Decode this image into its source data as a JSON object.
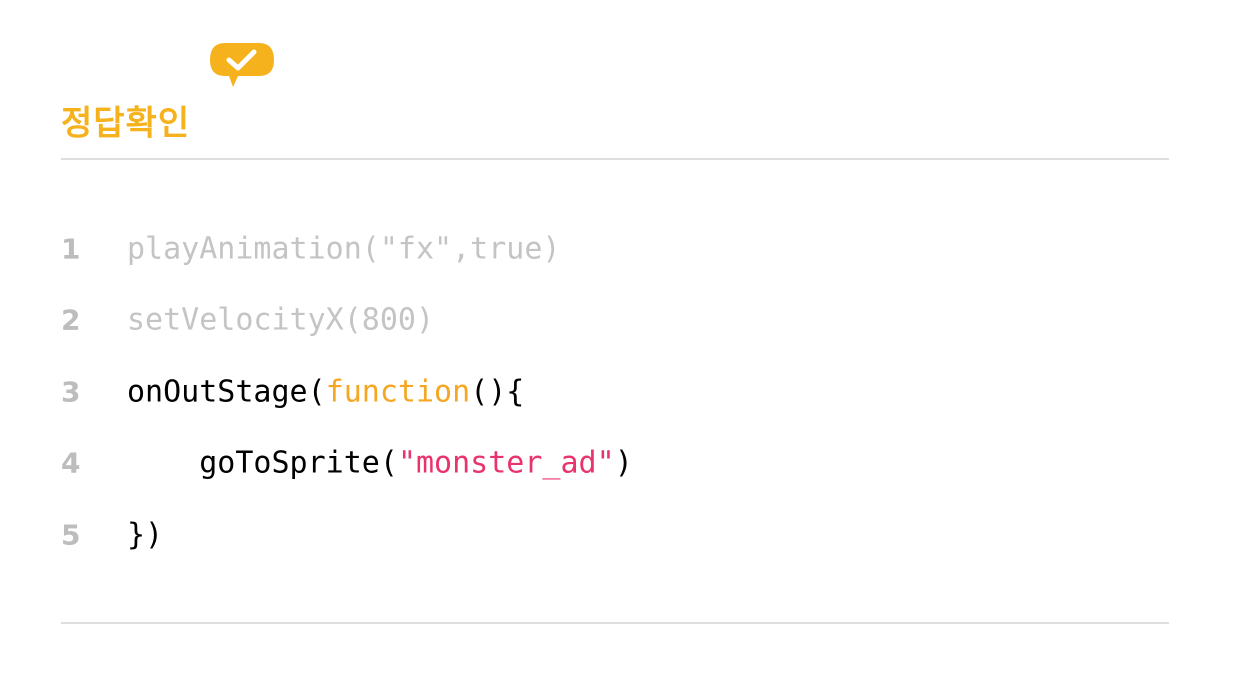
{
  "header": {
    "title": "정답확인",
    "badge_icon": "check-speech-bubble-icon"
  },
  "colors": {
    "accent": "#F5B21C",
    "keyword": "#F5A623",
    "string": "#E8336C",
    "line_number": "#BDBDBD",
    "dimmed_code": "#C4C4C4",
    "code": "#000000",
    "divider": "#DEDEDE"
  },
  "code": {
    "lines": [
      {
        "number": "1",
        "text": "playAnimation(\"fx\",true)"
      },
      {
        "number": "2",
        "text": "setVelocityX(800)"
      },
      {
        "number": "3",
        "pre": "onOutStage(",
        "keyword": "function",
        "post": "(){"
      },
      {
        "number": "4",
        "indent": "    ",
        "pre": "goToSprite(",
        "string": "\"monster_ad\"",
        "post": ")"
      },
      {
        "number": "5",
        "text": "})"
      }
    ]
  }
}
